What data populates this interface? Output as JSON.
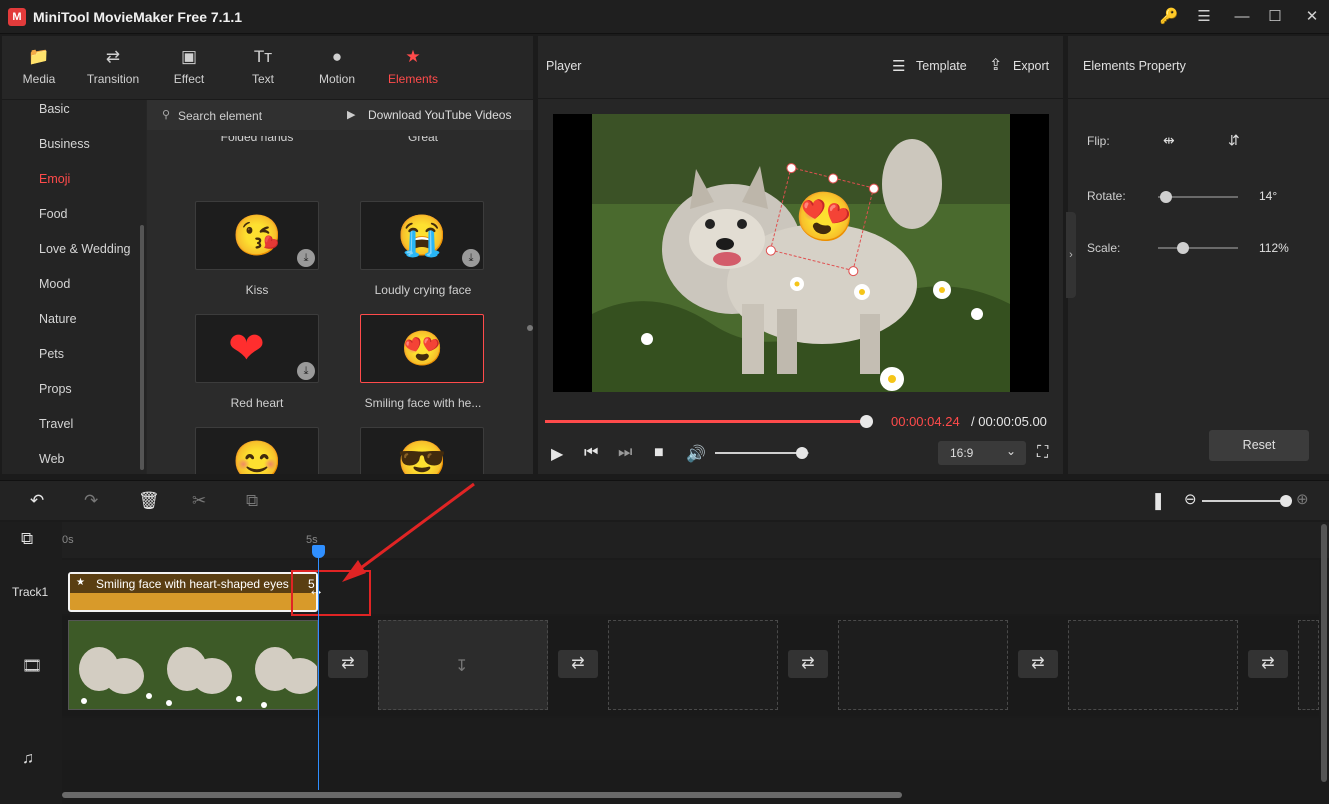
{
  "app": {
    "title": "MiniTool MovieMaker Free 7.1.1",
    "logo_letter": "M",
    "accent": "#ff4b4b"
  },
  "window_controls": {
    "key_icon": "🔑",
    "menu_icon": "☰",
    "minimize": "—",
    "maximize": "☐",
    "close": "✕"
  },
  "tabs": [
    {
      "label": "Media",
      "icon": "📁"
    },
    {
      "label": "Transition",
      "icon": "⇄"
    },
    {
      "label": "Effect",
      "icon": "▣"
    },
    {
      "label": "Text",
      "icon": "Tт"
    },
    {
      "label": "Motion",
      "icon": "●"
    },
    {
      "label": "Elements",
      "icon": "★"
    }
  ],
  "categories": [
    "Basic",
    "Business",
    "Emoji",
    "Food",
    "Love & Wedding",
    "Mood",
    "Nature",
    "Pets",
    "Props",
    "Travel",
    "Web"
  ],
  "active_category": "Emoji",
  "search": {
    "placeholder": "Search element",
    "youtube_label": "Download YouTube Videos"
  },
  "elements": {
    "partial_top_left": "Folded hands",
    "partial_top_right": "Great",
    "items": [
      {
        "label": "Kiss",
        "emoji": "😘"
      },
      {
        "label": "Loudly crying face",
        "emoji": "😭"
      },
      {
        "label": "Red heart",
        "emoji": "❤️"
      },
      {
        "label": "Smiling face with he...",
        "emoji": "😍"
      },
      {
        "label": "",
        "emoji": "😊"
      },
      {
        "label": "",
        "emoji": "😎"
      }
    ],
    "download_icon": "⤓"
  },
  "player": {
    "label": "Player",
    "template_label": "Template",
    "export_label": "Export",
    "current_time": "00:00:04.24",
    "total_time": " / 00:00:05.00",
    "aspect": "16:9",
    "overlay_emoji": "😍",
    "progress": 0.98,
    "volume": 0.93
  },
  "properties": {
    "title": "Elements Property",
    "flip_label": "Flip:",
    "rotate_label": "Rotate:",
    "rotate_value": "14°",
    "rotate_fraction": 0.1,
    "scale_label": "Scale:",
    "scale_value": "112%",
    "scale_fraction": 0.31,
    "reset_label": "Reset"
  },
  "timeline": {
    "ruler_start": "0s",
    "ruler_5s": "5s",
    "track1_label": "Track1",
    "clip_label": "Smiling face with heart-shaped eyes",
    "clip_color": "#d89a2a",
    "clip_end_digit": "5",
    "zoom_minus": "⊖",
    "zoom_plus": "⊕",
    "zoom": 1
  },
  "annotation_color": "#e02424"
}
